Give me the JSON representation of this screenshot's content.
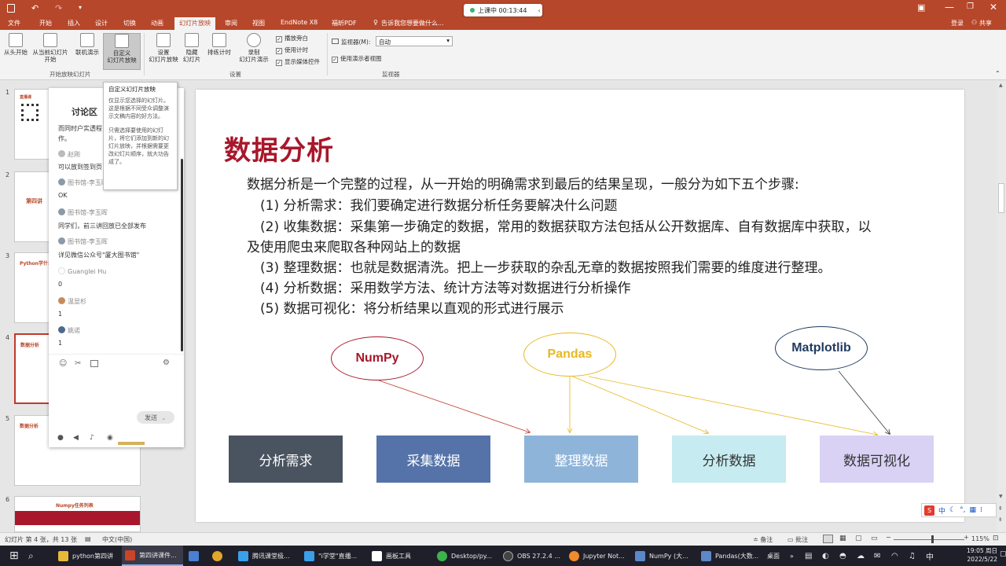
{
  "window": {
    "qat_icons": [
      "save-icon",
      "undo-icon",
      "redo-icon",
      "customize-icon"
    ],
    "recording": "上课中 00:13:44",
    "controls": [
      "ribbon-display-icon",
      "minimize-icon",
      "restore-icon",
      "close-icon"
    ]
  },
  "ribbon_tabs": [
    "文件",
    "开始",
    "插入",
    "设计",
    "切换",
    "动画",
    "幻灯片放映",
    "审阅",
    "视图",
    "EndNote X8",
    "福昕PDF"
  ],
  "ribbon_tab_active": "幻灯片放映",
  "tell_me": "告诉我您想要做什么...",
  "user": {
    "login": "登录",
    "share": "共享"
  },
  "ribbon": {
    "buttons": [
      "从头开始",
      "从当前幻灯片\n开始",
      "联机演示",
      "自定义\n幻灯片放映",
      "设置\n幻灯片放映",
      "隐藏\n幻灯片",
      "排练计时",
      "录制\n幻灯片演示"
    ],
    "checks": [
      "播放旁白",
      "使用计时",
      "显示媒体控件"
    ],
    "monitor_label": "监视器(M):",
    "monitor_value": "自动",
    "presenter_view": "使用演示者视图",
    "groups": [
      "开始放映幻灯片",
      "设置",
      "监视器"
    ]
  },
  "tooltip": {
    "title": "自定义幻灯片放映",
    "p1": "仅显示您选择的幻灯片。这是根据不同受众调整演示文稿内容的好方法。",
    "p2": "只需选择要使用的幻灯片，将它们添加到新的幻灯片放映，并根据需要更改幻灯片顺序，就大功告成了。"
  },
  "thumbnails": {
    "numbers": [
      "1",
      "2",
      "3",
      "4",
      "5",
      "6"
    ],
    "titles": [
      "",
      "第四讲",
      "Python学什么",
      "数据分析",
      "数据分析",
      "Numpy任务列表"
    ]
  },
  "chat": {
    "title": "讨论区",
    "messages": [
      {
        "name": "",
        "text": "而同时户实透程"
      },
      {
        "name": "",
        "text": "作。"
      },
      {
        "name": "赵刚",
        "text": "可以放到签到页"
      },
      {
        "name": "图书馆-李玉晖",
        "text": "OK"
      },
      {
        "name": "图书馆-李玉晖",
        "text": "同学们，前三讲回放已全部发布"
      },
      {
        "name": "图书馆-李玉晖",
        "text": "详见微信公众号\"厦大图书馆\""
      },
      {
        "name": "Guanglei Hu",
        "text": "0"
      },
      {
        "name": "温显杉",
        "text": "1"
      },
      {
        "name": "姚诺",
        "text": "1"
      }
    ],
    "toolbar_icons": [
      "emoji-icon",
      "scissors-icon",
      "image-icon",
      "settings-icon"
    ],
    "send": "发送",
    "bottom_icons": [
      "mic-icon",
      "speaker-icon",
      "music-icon",
      "location-icon"
    ]
  },
  "slide": {
    "title": "数据分析",
    "intro": "数据分析是一个完整的过程，从一开始的明确需求到最后的结果呈现，一般分为如下五个步骤:",
    "steps": [
      "(1) 分析需求：我们要确定进行数据分析任务要解决什么问题",
      "(2) 收集数据：采集第一步确定的数据，常用的数据获取方法包括从公开数据库、自有数据库中获取，以",
      "及使用爬虫来爬取各种网站上的数据",
      "(3) 整理数据：也就是数据清洗。把上一步获取的杂乱无章的数据按照我们需要的维度进行整理。",
      "(4) 分析数据：采用数学方法、统计方法等对数据进行分析操作",
      "(5) 数据可视化：将分析结果以直观的形式进行展示"
    ],
    "tools": [
      "NumPy",
      "Pandas",
      "Matplotlib"
    ],
    "stages": [
      "分析需求",
      "采集数据",
      "整理数据",
      "分析数据",
      "数据可视化"
    ]
  },
  "status": {
    "slide_info": "幻灯片 第 4 张，共 13 张",
    "language": "中文(中国)",
    "notes": "备注",
    "comments": "批注",
    "zoom": "115%"
  },
  "ime": "中",
  "taskbar": {
    "items": [
      "python第四讲",
      "第四讲课件...",
      "",
      "",
      "腾讯课堂极...",
      "\"i学堂\"直播...",
      "画板工具",
      "Desktop/py...",
      "OBS 27.2.4 ...",
      "Jupyter Not...",
      "NumPy (大...",
      "Pandas(大数..."
    ],
    "desktop": "桌面",
    "time": "19:05 周日",
    "date": "2022/5/22"
  },
  "colors": {
    "brand": "#b7472a",
    "title_red": "#a8172b"
  }
}
